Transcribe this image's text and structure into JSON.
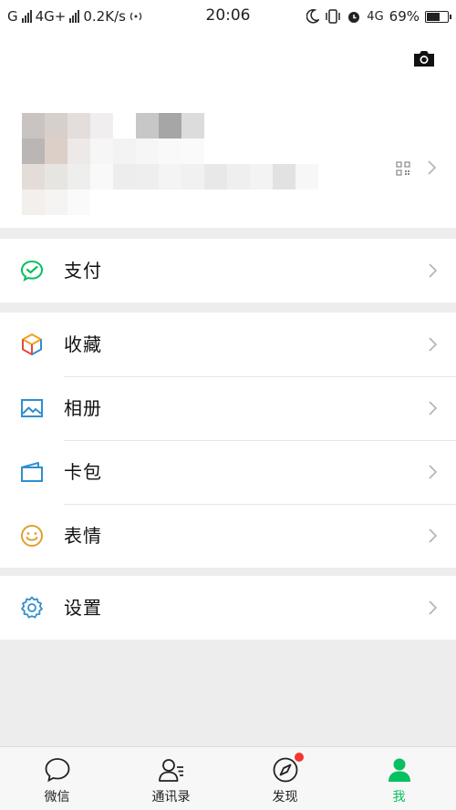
{
  "statusbar": {
    "carrier1": "G",
    "carrier2": "4G+",
    "speed": "0.2K/s",
    "time": "20:06",
    "network": "4G",
    "battery_text": "69%",
    "battery_level": 0.69
  },
  "profile": {
    "camera_icon": "camera-icon",
    "qr_icon": "qr-code-icon"
  },
  "menu": {
    "pay": "支付",
    "favorites": "收藏",
    "album": "相册",
    "cards": "卡包",
    "stickers": "表情",
    "settings": "设置"
  },
  "tabs": {
    "chats": "微信",
    "contacts": "通讯录",
    "discover": "发现",
    "me": "我"
  },
  "colors": {
    "accent_green": "#07c160",
    "badge_red": "#f43530",
    "icon_blue": "#2f8fd0",
    "sticker_orange": "#e0a030"
  }
}
